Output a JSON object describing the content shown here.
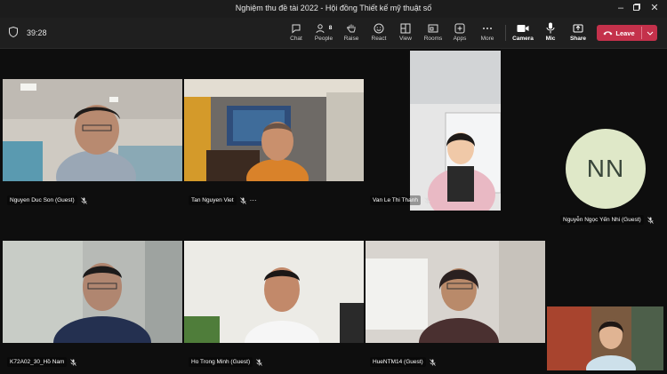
{
  "window": {
    "title": "Nghiệm thu đề tài 2022 - Hội đồng Thiết kế mỹ thuật số",
    "controls": [
      "minimize",
      "maximize",
      "close"
    ]
  },
  "meeting": {
    "timer": "39:28"
  },
  "toolbar": {
    "buttons": [
      {
        "id": "chat",
        "label": "Chat",
        "icon": "chat-icon"
      },
      {
        "id": "people",
        "label": "People",
        "icon": "people-icon",
        "badge": "8"
      },
      {
        "id": "raise",
        "label": "Raise",
        "icon": "hand-icon"
      },
      {
        "id": "react",
        "label": "React",
        "icon": "smiley-icon"
      },
      {
        "id": "view",
        "label": "View",
        "icon": "view-icon"
      },
      {
        "id": "rooms",
        "label": "Rooms",
        "icon": "rooms-icon"
      },
      {
        "id": "apps",
        "label": "Apps",
        "icon": "apps-icon"
      },
      {
        "id": "more",
        "label": "More",
        "icon": "ellipsis-icon"
      },
      {
        "id": "camera",
        "label": "Camera",
        "icon": "camera-icon"
      },
      {
        "id": "mic",
        "label": "Mic",
        "icon": "microphone-icon"
      },
      {
        "id": "share",
        "label": "Share",
        "icon": "share-icon"
      }
    ],
    "leave_label": "Leave",
    "leave_color": "#c4314b"
  },
  "participants": [
    {
      "name": "Nguyen Duc Son (Guest)",
      "muted": true
    },
    {
      "name": "Tan Nguyen Viet",
      "muted": true,
      "more": "···"
    },
    {
      "name": "Van Le Thi Thanh",
      "muted": true
    },
    {
      "name": "K72A02_30_Hồ Nam",
      "muted": true
    },
    {
      "name": "Ho Trong Minh (Guest)",
      "muted": true
    },
    {
      "name": "HueNTM14 (Guest)",
      "muted": true
    },
    {
      "name": "Nguyễn Ngọc Yến Nhi (Guest)",
      "initials": "NN",
      "muted": true
    }
  ]
}
